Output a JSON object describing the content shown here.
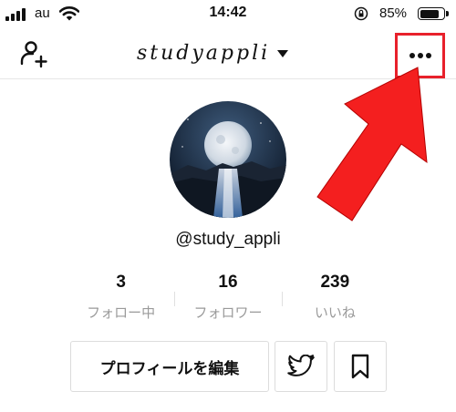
{
  "status_bar": {
    "carrier": "au",
    "time": "14:42",
    "battery_percent": "85%",
    "battery_level": 0.85,
    "icons": [
      "signal-icon",
      "wifi-icon",
      "rotation-lock-icon",
      "battery-icon"
    ]
  },
  "nav": {
    "title": "studyappli",
    "icons": [
      "add-user-icon",
      "chevron-down-icon",
      "more-horizontal-icon"
    ],
    "highlight_color": "#e8212b"
  },
  "profile": {
    "username": "@study_appli",
    "stats": [
      {
        "value": "3",
        "label": "フォロー中"
      },
      {
        "value": "16",
        "label": "フォロワー"
      },
      {
        "value": "239",
        "label": "いいね"
      }
    ]
  },
  "actions": {
    "edit_profile_label": "プロフィールを編集",
    "icons": [
      "twitter-icon",
      "bookmark-icon"
    ]
  },
  "annotation": {
    "arrow_color": "#f41f1f"
  }
}
